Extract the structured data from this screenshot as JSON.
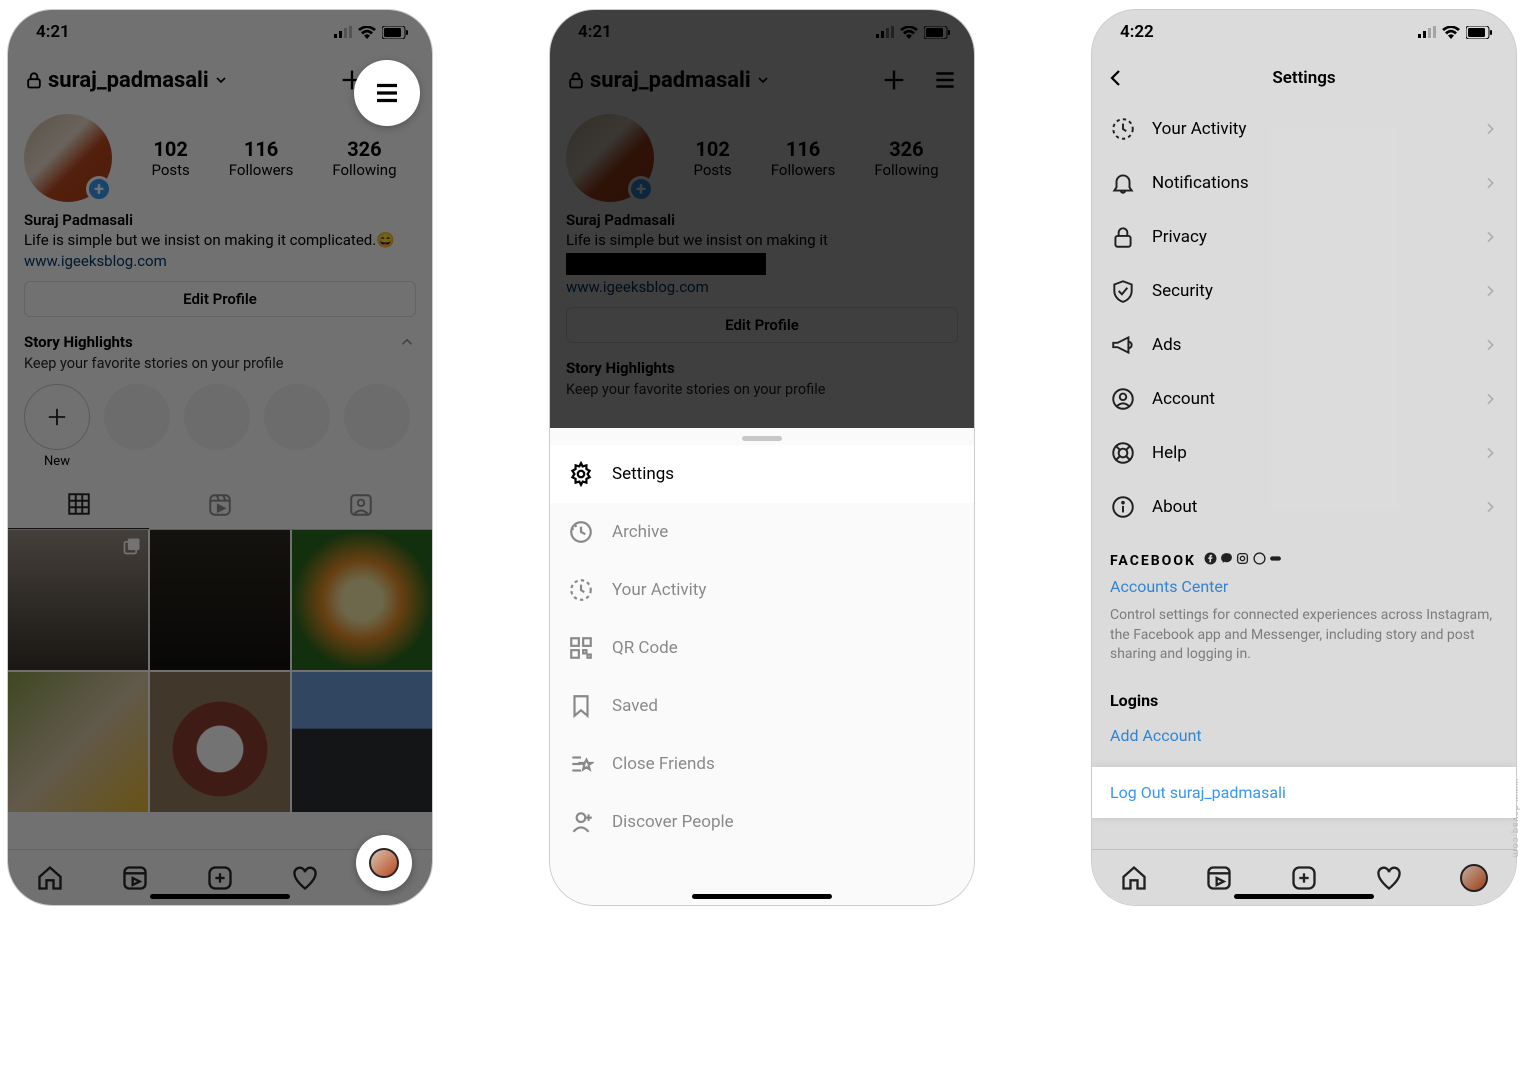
{
  "screen1": {
    "status": {
      "time": "4:21"
    },
    "username": "suraj_padmasali",
    "stats": {
      "posts": {
        "num": "102",
        "label": "Posts"
      },
      "followers": {
        "num": "116",
        "label": "Followers"
      },
      "following": {
        "num": "326",
        "label": "Following"
      }
    },
    "bio": {
      "name": "Suraj Padmasali",
      "text": "Life is simple but we insist on making it complicated.",
      "emoji": "😄",
      "link": "www.igeeksblog.com"
    },
    "edit_profile": "Edit Profile",
    "highlights": {
      "title": "Story Highlights",
      "subtitle": "Keep your favorite stories on your profile",
      "new_label": "New"
    }
  },
  "screen2": {
    "status": {
      "time": "4:21"
    },
    "username": "suraj_padmasali",
    "stats": {
      "posts": {
        "num": "102",
        "label": "Posts"
      },
      "followers": {
        "num": "116",
        "label": "Followers"
      },
      "following": {
        "num": "326",
        "label": "Following"
      }
    },
    "bio": {
      "name": "Suraj Padmasali",
      "text": "Life is simple but we insist on making it",
      "link": "www.igeeksblog.com"
    },
    "edit_profile": "Edit Profile",
    "highlights": {
      "title": "Story Highlights",
      "subtitle": "Keep your favorite stories on your profile"
    },
    "sheet": {
      "settings": "Settings",
      "archive": "Archive",
      "activity": "Your Activity",
      "qr": "QR Code",
      "saved": "Saved",
      "close_friends": "Close Friends",
      "discover": "Discover People"
    }
  },
  "screen3": {
    "status": {
      "time": "4:22"
    },
    "title": "Settings",
    "items": {
      "activity": "Your Activity",
      "notifications": "Notifications",
      "privacy": "Privacy",
      "security": "Security",
      "ads": "Ads",
      "account": "Account",
      "help": "Help",
      "about": "About"
    },
    "facebook": {
      "brand": "FACEBOOK",
      "accounts_center": "Accounts Center",
      "desc": "Control settings for connected experiences across Instagram, the Facebook app and Messenger, including story and post sharing and logging in."
    },
    "logins": {
      "header": "Logins",
      "add": "Add Account",
      "logout": "Log Out suraj_padmasali"
    }
  },
  "watermark": "www.devaq.com"
}
